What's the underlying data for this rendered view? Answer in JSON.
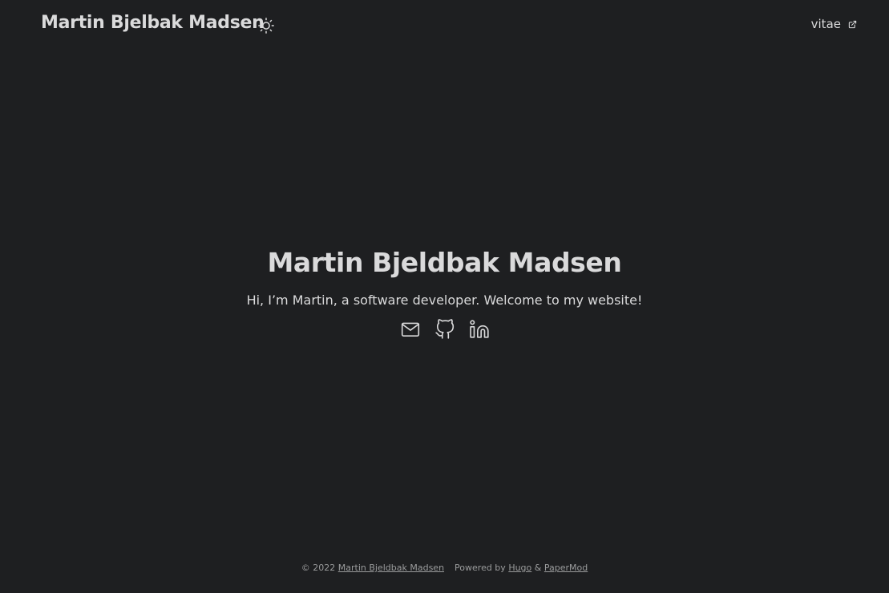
{
  "header": {
    "site_title": "Martin Bjelbak Madsen",
    "theme_toggle_icon": "sun-icon",
    "nav": {
      "vitae_label": "vitae",
      "external_icon": "external-link-icon"
    }
  },
  "hero": {
    "title": "Martin Bjeldbak Madsen",
    "subtitle": "Hi, I’m Martin, a software developer. Welcome to my website!",
    "social_icons": [
      "mail-icon",
      "github-icon",
      "linkedin-icon"
    ]
  },
  "footer": {
    "copyright": "© 2022",
    "owner_link": "Martin Bjeldbak Madsen",
    "powered_by": "Powered by",
    "hugo_link": "Hugo",
    "ampersand": "&",
    "papermod_link": "PaperMod"
  },
  "colors": {
    "background": "#1e1f21",
    "primary_text": "#dadadb",
    "secondary_text": "#9b9c9d"
  }
}
